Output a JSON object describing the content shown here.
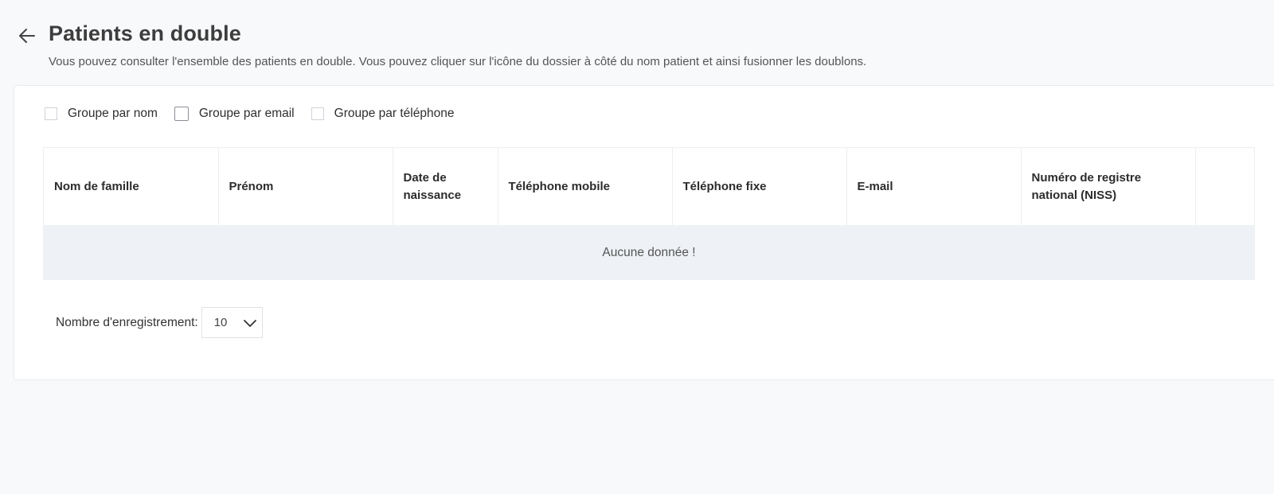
{
  "header": {
    "title": "Patients en double",
    "description": "Vous pouvez consulter l'ensemble des patients en double. Vous pouvez cliquer sur l'icône du dossier à côté du nom patient et ainsi fusionner les doublons.",
    "back_icon": "arrow-left-icon"
  },
  "filters": [
    {
      "label": "Groupe par nom",
      "checked": false
    },
    {
      "label": "Groupe par email",
      "checked": false
    },
    {
      "label": "Groupe par téléphone",
      "checked": false
    }
  ],
  "table": {
    "columns": [
      "Nom de famille",
      "Prénom",
      "Date de naissance",
      "Téléphone mobile",
      "Téléphone fixe",
      "E-mail",
      "Numéro de registre national (NISS)",
      ""
    ],
    "rows": [],
    "empty_text": "Aucune donnée !"
  },
  "pager": {
    "label": "Nombre d'enregistrement:",
    "page_size": "10",
    "dropdown_icon": "chevron-down-icon"
  },
  "colors": {
    "background": "#f8f9fb",
    "card": "#ffffff",
    "empty_row": "#eef1f5",
    "border": "#eceef1"
  }
}
